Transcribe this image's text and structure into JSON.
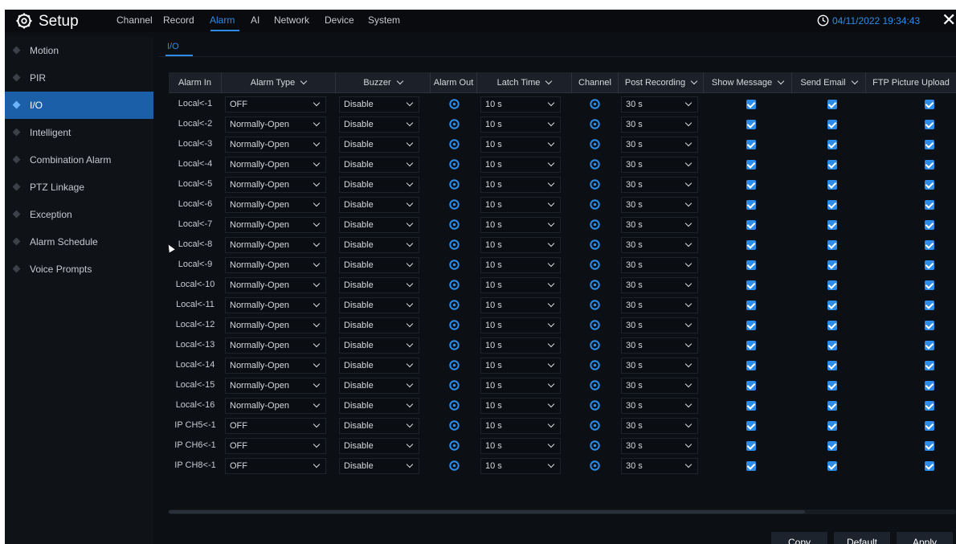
{
  "header": {
    "title": "Setup",
    "tabs": [
      {
        "label": "Channel",
        "active": false
      },
      {
        "label": "Record",
        "active": false
      },
      {
        "label": "Alarm",
        "active": true
      },
      {
        "label": "AI",
        "active": false
      },
      {
        "label": "Network",
        "active": false
      },
      {
        "label": "Device",
        "active": false
      },
      {
        "label": "System",
        "active": false
      }
    ],
    "datetime": "04/11/2022 19:34:43",
    "close_label": "✕",
    "accent_color": "#2d8ce8"
  },
  "sidebar": {
    "items": [
      {
        "label": "Motion",
        "active": false
      },
      {
        "label": "PIR",
        "active": false
      },
      {
        "label": "I/O",
        "active": true
      },
      {
        "label": "Intelligent",
        "active": false
      },
      {
        "label": "Combination Alarm",
        "active": false
      },
      {
        "label": "PTZ Linkage",
        "active": false
      },
      {
        "label": "Exception",
        "active": false
      },
      {
        "label": "Alarm Schedule",
        "active": false
      },
      {
        "label": "Voice Prompts",
        "active": false
      }
    ]
  },
  "subtabs": [
    {
      "label": "I/O",
      "active": true
    }
  ],
  "table": {
    "headers": [
      "Alarm In",
      "Alarm Type",
      "Buzzer",
      "Alarm Out",
      "Latch Time",
      "Channel",
      "Post Recording",
      "Show Message",
      "Send Email",
      "FTP Picture Upload"
    ],
    "rows": [
      {
        "alarm_in": "Local<-1",
        "alarm_type": "OFF",
        "buzzer": "Disable",
        "latch_time": "10 s",
        "post_recording": "30 s",
        "show_message": true,
        "send_email": true,
        "ftp_upload": true
      },
      {
        "alarm_in": "Local<-2",
        "alarm_type": "Normally-Open",
        "buzzer": "Disable",
        "latch_time": "10 s",
        "post_recording": "30 s",
        "show_message": true,
        "send_email": true,
        "ftp_upload": true
      },
      {
        "alarm_in": "Local<-3",
        "alarm_type": "Normally-Open",
        "buzzer": "Disable",
        "latch_time": "10 s",
        "post_recording": "30 s",
        "show_message": true,
        "send_email": true,
        "ftp_upload": true
      },
      {
        "alarm_in": "Local<-4",
        "alarm_type": "Normally-Open",
        "buzzer": "Disable",
        "latch_time": "10 s",
        "post_recording": "30 s",
        "show_message": true,
        "send_email": true,
        "ftp_upload": true
      },
      {
        "alarm_in": "Local<-5",
        "alarm_type": "Normally-Open",
        "buzzer": "Disable",
        "latch_time": "10 s",
        "post_recording": "30 s",
        "show_message": true,
        "send_email": true,
        "ftp_upload": true
      },
      {
        "alarm_in": "Local<-6",
        "alarm_type": "Normally-Open",
        "buzzer": "Disable",
        "latch_time": "10 s",
        "post_recording": "30 s",
        "show_message": true,
        "send_email": true,
        "ftp_upload": true
      },
      {
        "alarm_in": "Local<-7",
        "alarm_type": "Normally-Open",
        "buzzer": "Disable",
        "latch_time": "10 s",
        "post_recording": "30 s",
        "show_message": true,
        "send_email": true,
        "ftp_upload": true
      },
      {
        "alarm_in": "Local<-8",
        "alarm_type": "Normally-Open",
        "buzzer": "Disable",
        "latch_time": "10 s",
        "post_recording": "30 s",
        "show_message": true,
        "send_email": true,
        "ftp_upload": true
      },
      {
        "alarm_in": "Local<-9",
        "alarm_type": "Normally-Open",
        "buzzer": "Disable",
        "latch_time": "10 s",
        "post_recording": "30 s",
        "show_message": true,
        "send_email": true,
        "ftp_upload": true
      },
      {
        "alarm_in": "Local<-10",
        "alarm_type": "Normally-Open",
        "buzzer": "Disable",
        "latch_time": "10 s",
        "post_recording": "30 s",
        "show_message": true,
        "send_email": true,
        "ftp_upload": true
      },
      {
        "alarm_in": "Local<-11",
        "alarm_type": "Normally-Open",
        "buzzer": "Disable",
        "latch_time": "10 s",
        "post_recording": "30 s",
        "show_message": true,
        "send_email": true,
        "ftp_upload": true
      },
      {
        "alarm_in": "Local<-12",
        "alarm_type": "Normally-Open",
        "buzzer": "Disable",
        "latch_time": "10 s",
        "post_recording": "30 s",
        "show_message": true,
        "send_email": true,
        "ftp_upload": true
      },
      {
        "alarm_in": "Local<-13",
        "alarm_type": "Normally-Open",
        "buzzer": "Disable",
        "latch_time": "10 s",
        "post_recording": "30 s",
        "show_message": true,
        "send_email": true,
        "ftp_upload": true
      },
      {
        "alarm_in": "Local<-14",
        "alarm_type": "Normally-Open",
        "buzzer": "Disable",
        "latch_time": "10 s",
        "post_recording": "30 s",
        "show_message": true,
        "send_email": true,
        "ftp_upload": true
      },
      {
        "alarm_in": "Local<-15",
        "alarm_type": "Normally-Open",
        "buzzer": "Disable",
        "latch_time": "10 s",
        "post_recording": "30 s",
        "show_message": true,
        "send_email": true,
        "ftp_upload": true
      },
      {
        "alarm_in": "Local<-16",
        "alarm_type": "Normally-Open",
        "buzzer": "Disable",
        "latch_time": "10 s",
        "post_recording": "30 s",
        "show_message": true,
        "send_email": true,
        "ftp_upload": true
      },
      {
        "alarm_in": "IP CH5<-1",
        "alarm_type": "OFF",
        "buzzer": "Disable",
        "latch_time": "10 s",
        "post_recording": "30 s",
        "show_message": true,
        "send_email": true,
        "ftp_upload": true
      },
      {
        "alarm_in": "IP CH6<-1",
        "alarm_type": "OFF",
        "buzzer": "Disable",
        "latch_time": "10 s",
        "post_recording": "30 s",
        "show_message": true,
        "send_email": true,
        "ftp_upload": true
      },
      {
        "alarm_in": "IP CH8<-1",
        "alarm_type": "OFF",
        "buzzer": "Disable",
        "latch_time": "10 s",
        "post_recording": "30 s",
        "show_message": true,
        "send_email": true,
        "ftp_upload": true
      }
    ]
  },
  "footer": {
    "copy_label": "Copy",
    "default_label": "Default",
    "apply_label": "Apply"
  }
}
